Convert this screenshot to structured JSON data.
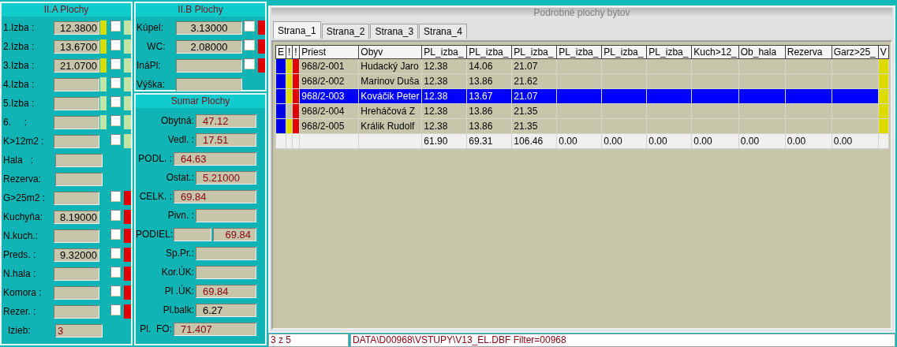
{
  "panel_a": {
    "title": "II.A Plochy",
    "rows": [
      {
        "kind": "check",
        "label": "1.Izba :",
        "value": "12.3800",
        "marker": {
          "color": "#dcdc00"
        },
        "checked": false,
        "flag": {
          "color": "#c4e4a4"
        }
      },
      {
        "kind": "check",
        "label": "2.Izba :",
        "value": "13.6700",
        "marker": {
          "color": "#dcdc00"
        },
        "checked": false,
        "flag": {
          "color": "#c4e4a4"
        }
      },
      {
        "kind": "check",
        "label": "3.Izba :",
        "value": "21.0700",
        "marker": {
          "color": "#dcdc00"
        },
        "checked": false,
        "flag": {
          "color": "#c4e4a4"
        }
      },
      {
        "kind": "check",
        "label": "4.Izba :",
        "marker": {
          "color": "#c4e4a4"
        },
        "checked": false,
        "flag": {
          "color": "#c4e4a4"
        }
      },
      {
        "kind": "check",
        "label": "5.Izba :",
        "marker": {
          "color": "#c4e4a4"
        },
        "checked": false,
        "flag": {
          "color": "#c4e4a4"
        }
      },
      {
        "kind": "check",
        "label": "6.     :",
        "marker": {
          "color": "#c4e4a4"
        },
        "checked": false,
        "flag": {
          "color": "#c4e4a4"
        }
      },
      {
        "kind": "check",
        "label": "K>12m2 :",
        "checked": false,
        "flag": {
          "color": "#c4e4a4"
        }
      },
      {
        "kind": "plain",
        "label": "Hala   :"
      },
      {
        "kind": "plain",
        "label": "Rezerva:"
      },
      {
        "kind": "check",
        "label": "G>25m2 :",
        "checked": false,
        "flag": {
          "color": "#e00000"
        }
      },
      {
        "kind": "check",
        "label": "Kuchyňa:",
        "value": "8.19000",
        "checked": false,
        "flag": {
          "color": "#e00000"
        }
      },
      {
        "kind": "check",
        "label": "N.kuch.:",
        "checked": false,
        "flag": {
          "color": "#e00000"
        }
      },
      {
        "kind": "check",
        "label": "Preds. :",
        "value": "9.32000",
        "checked": false,
        "flag": {
          "color": "#e00000"
        }
      },
      {
        "kind": "check",
        "label": "N.hala :",
        "checked": false,
        "flag": {
          "color": "#e00000"
        }
      },
      {
        "kind": "check",
        "label": "Komora :",
        "checked": false,
        "flag": {
          "color": "#e00000"
        }
      },
      {
        "kind": "check",
        "label": "Rezer. :",
        "checked": false,
        "flag": {
          "color": "#e00000"
        }
      },
      {
        "kind": "total",
        "label": "Izieb:",
        "value": "3"
      }
    ]
  },
  "panel_b": {
    "title": "II.B Plochy",
    "rows": [
      {
        "kind": "check",
        "label": "Kúpel:",
        "value": "3.13000",
        "checked": false,
        "flag": {
          "color": "#e00000"
        }
      },
      {
        "kind": "check",
        "label": "WC:",
        "value": "2.08000",
        "checked": false,
        "flag": {
          "color": "#e00000"
        }
      },
      {
        "kind": "check",
        "label": "InáPl:",
        "checked": false,
        "flag": {
          "color": "#e00000"
        }
      },
      {
        "kind": "plain",
        "label": "Výška:"
      }
    ]
  },
  "summary": {
    "title": "Sumar Plochy",
    "rows": [
      {
        "kind": "short",
        "label": "Obytná:",
        "value": "47.12",
        "emphasis": true
      },
      {
        "kind": "short",
        "label": "Vedl. :",
        "value": "17.51",
        "emphasis": true
      },
      {
        "kind": "wide",
        "label": "PODL. :",
        "value": "64.63",
        "emphasis": true
      },
      {
        "kind": "short",
        "label": "Ostat.:",
        "value": "5.21000",
        "emphasis": true
      },
      {
        "kind": "wide",
        "label": "CELK. :",
        "value": "69.84",
        "emphasis": true
      },
      {
        "kind": "short",
        "label": "Pivn. :"
      },
      {
        "kind": "split",
        "label": "PODIEL:",
        "value_2": "69.84",
        "emphasis": true
      },
      {
        "kind": "short",
        "label": "Sp.Pr.:"
      },
      {
        "kind": "short",
        "label": "Kor.ÚK:"
      },
      {
        "kind": "short",
        "label": "Pl .ÚK:",
        "value": "69.84",
        "emphasis": true
      },
      {
        "kind": "short",
        "label": "Pl.balk:",
        "value": "6.27",
        "emphasis": false
      },
      {
        "kind": "wide",
        "label": "Pl.  FO:",
        "value": "71.407",
        "emphasis": true
      }
    ]
  },
  "detail": {
    "title": "Podrobné plochy bytov",
    "tabs": [
      {
        "label": "Strana_1",
        "selected": true
      },
      {
        "label": "Strana_2",
        "selected": false
      },
      {
        "label": "Strana_3",
        "selected": false
      },
      {
        "label": "Strana_4",
        "selected": false
      }
    ],
    "grid": {
      "columns": [
        "E",
        "!",
        "!",
        "Priest",
        "Obyv",
        "PL_izba_",
        "PL_izba_",
        "PL_izba_",
        "PL_izba_",
        "PL_izba_",
        "PL_izba_",
        "Kuch>12_",
        "Ob_hala",
        "Rezerva",
        "Garz>25_",
        "V"
      ],
      "rows": [
        {
          "e": true,
          "warn": true,
          "alert": true,
          "v": true,
          "selected": false,
          "priest": "968/2-001",
          "obyv": "Hudacký Jaro",
          "values": [
            "12.38",
            "14.06",
            "21.07"
          ]
        },
        {
          "e": true,
          "warn": true,
          "alert": true,
          "v": true,
          "selected": false,
          "priest": "968/2-002",
          "obyv": "Marinov Duša",
          "values": [
            "12.38",
            "13.86",
            "21.62"
          ]
        },
        {
          "e": true,
          "warn": true,
          "alert": true,
          "v": true,
          "selected": true,
          "priest": "968/2-003",
          "obyv": "Kováčik Peter",
          "values": [
            "12.38",
            "13.67",
            "21.07"
          ]
        },
        {
          "e": true,
          "warn": false,
          "alert": true,
          "v": true,
          "selected": false,
          "priest": "968/2-004",
          "obyv": "Hreháčová Z",
          "values": [
            "12.38",
            "13.86",
            "21.35"
          ]
        },
        {
          "e": true,
          "warn": true,
          "alert": true,
          "v": true,
          "selected": false,
          "priest": "968/2-005",
          "obyv": "Králik Rudolf",
          "values": [
            "12.38",
            "13.86",
            "21.35"
          ]
        }
      ],
      "totals": [
        "61.90",
        "69.31",
        "106.46",
        "0.00",
        "0.00",
        "0.00",
        "0.00",
        "0.00",
        "0.00",
        "0.00"
      ]
    }
  },
  "status_bar": [
    "3 z 5",
    "DATA\\D00968\\VSTUPY\\V13_EL.DBF Filter=00968"
  ]
}
